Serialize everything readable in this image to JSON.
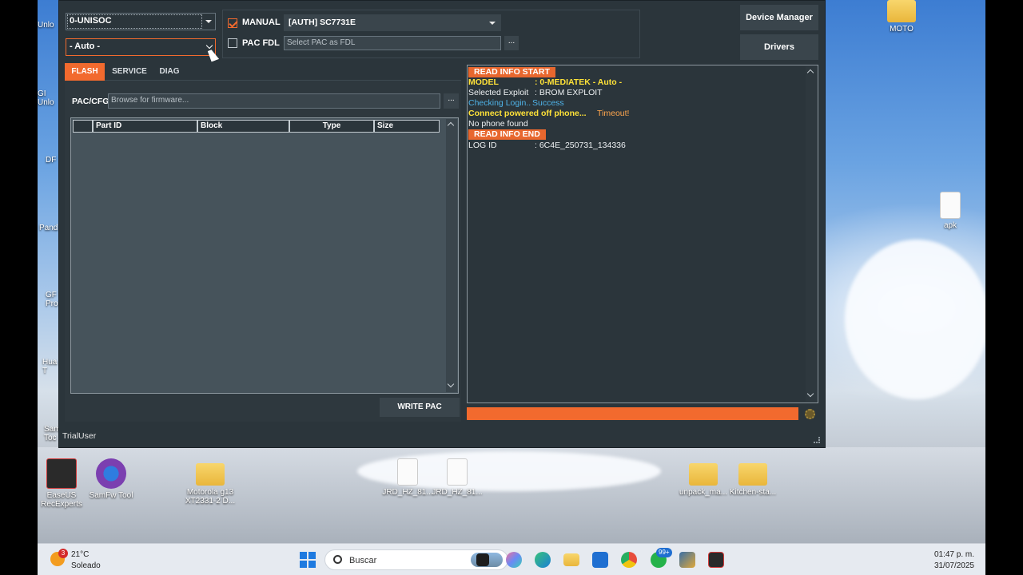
{
  "app": {
    "platform_select": "0-UNISOC",
    "mode_select": "- Auto -",
    "manual_label": "MANUAL",
    "manual_checked": true,
    "auth_select": "[AUTH] SC7731E",
    "pac_fdl_label": "PAC FDL",
    "pac_fdl_checked": false,
    "pac_fdl_placeholder": "Select PAC as FDL",
    "pac_fdl_browse": "...",
    "device_manager": "Device Manager",
    "drivers": "Drivers",
    "tabs": [
      "FLASH",
      "SERVICE",
      "DIAG"
    ],
    "active_tab": "FLASH",
    "pac_cfg_label": "PAC/CFG",
    "firmware_placeholder": "Browse for firmware...",
    "firmware_browse": "...",
    "columns": [
      "",
      "Part ID",
      "Block",
      "Type",
      "Size"
    ],
    "write_pac": "WRITE PAC",
    "status_user": "TrialUser",
    "progress_percent": 100,
    "log": {
      "start_tag": "READ INFO START",
      "model_key": "MODEL",
      "model_val": ": 0-MEDIATEK - Auto -",
      "exploit_key": "Selected Exploit",
      "exploit_val": ": BROM EXPLOIT",
      "login_a": "Checking Login..",
      "login_b": "Success",
      "connect_a": "Connect powered off phone...",
      "connect_b": "Timeout!",
      "no_phone": "No phone found",
      "end_tag": "READ INFO END",
      "logid_key": "LOG ID",
      "logid_val": ": 6C4E_250731_134336"
    }
  },
  "desktop": {
    "icons": {
      "moto": "MOTO",
      "apk": "apk",
      "easeus": "EaseUS RecExperts",
      "samfw": "SamFw Tool",
      "motorola": "Motorola g13 XT2331-2 D...",
      "jrd1": "JRD_HZ_81...",
      "jrd2": "JRD_HZ_81...",
      "unpack": "unpack_ma...",
      "kitchen": "Kitchen-sta..."
    },
    "left_edge_labels": [
      "Unlo",
      "GI Unlo",
      "DF",
      "Pand",
      "GF Pro",
      "Hua T",
      "Sam Toc"
    ]
  },
  "taskbar": {
    "weather_temp": "21°C",
    "weather_cond": "Soleado",
    "weather_badge": "3",
    "search_placeholder": "Buscar",
    "whatsapp_badge": "99+",
    "time": "01:47 p. m.",
    "date": "31/07/2025"
  },
  "colors": {
    "accent": "#f26a2e",
    "window_bg": "#2b353b",
    "log_yellow": "#ffe238",
    "log_blue": "#4fb3e8"
  }
}
